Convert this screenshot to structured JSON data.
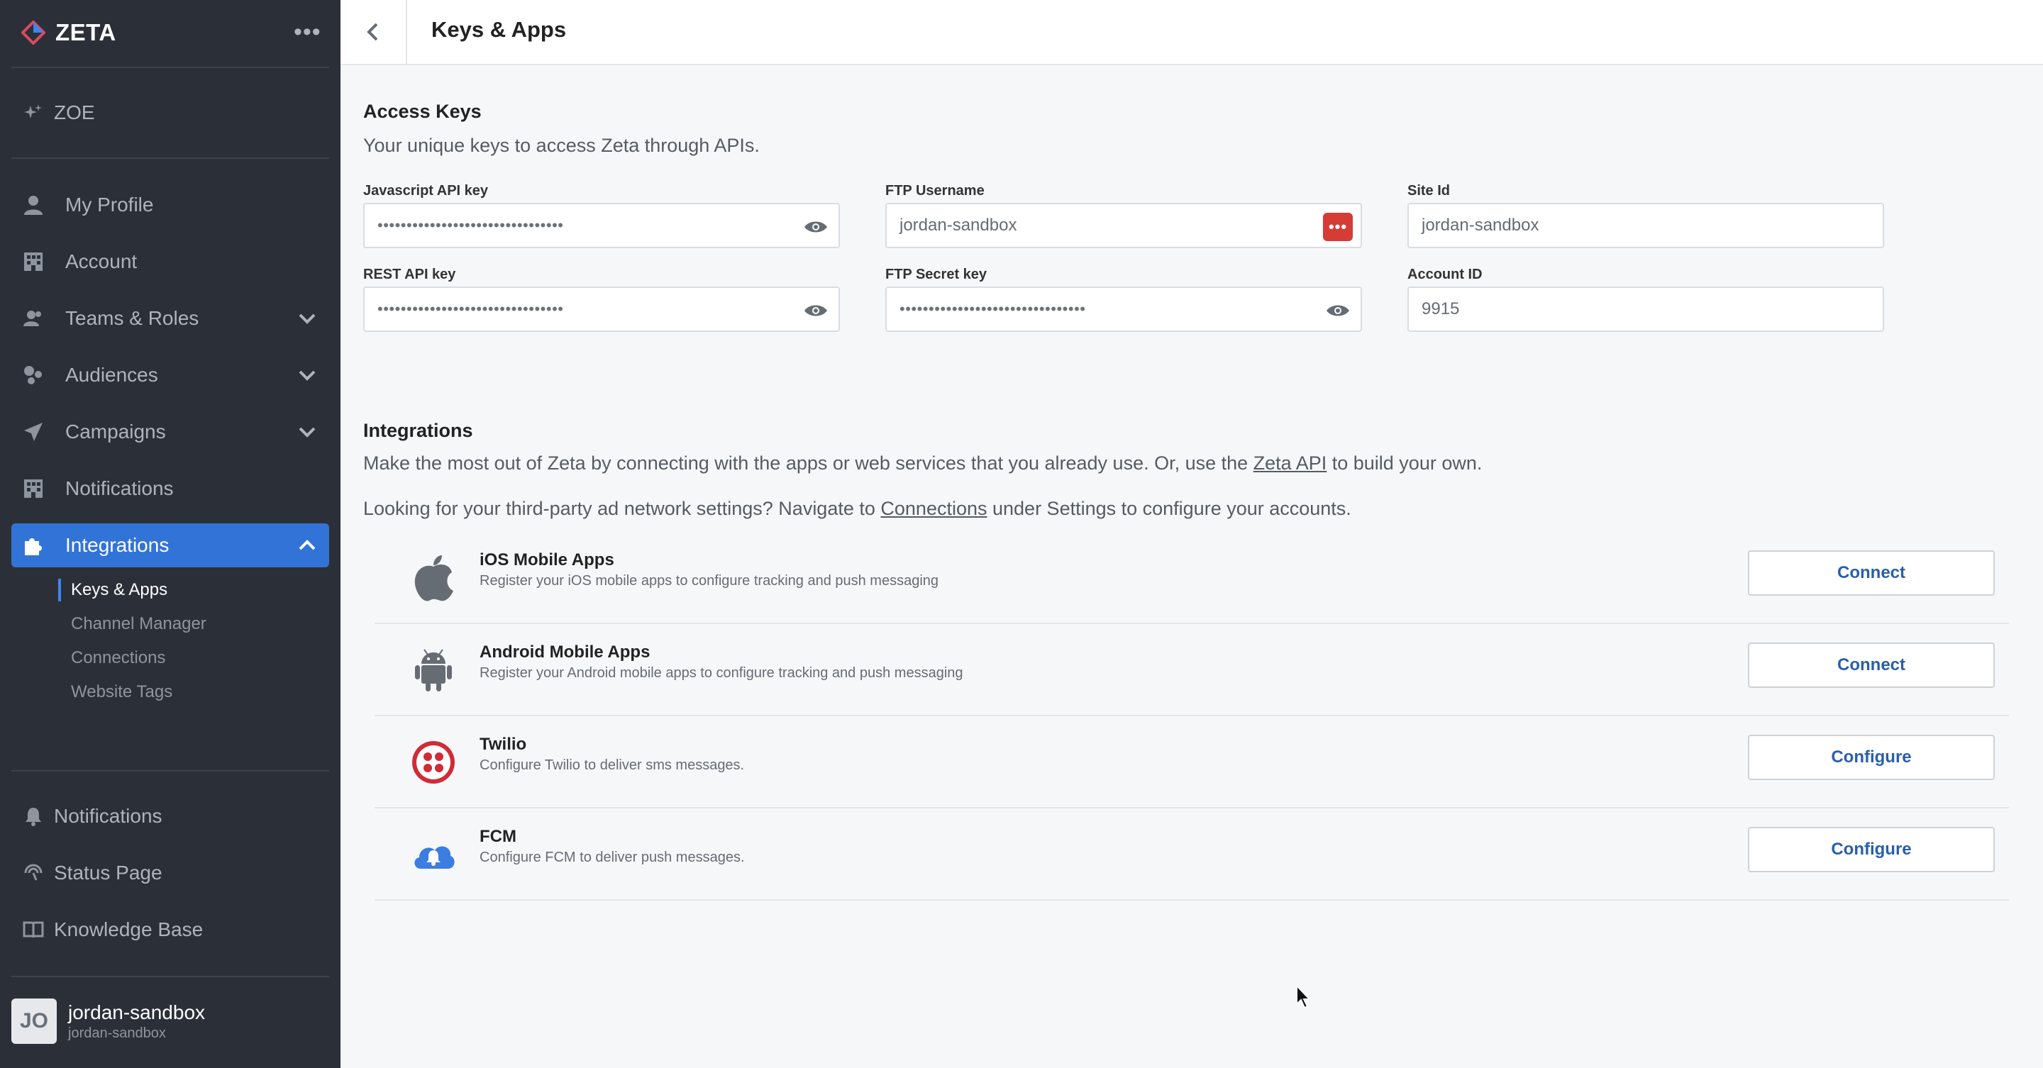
{
  "brand": {
    "name": "ZETA"
  },
  "sidebar": {
    "top_item": {
      "label": "ZOE"
    },
    "items": [
      {
        "label": "My Profile"
      },
      {
        "label": "Account"
      },
      {
        "label": "Teams & Roles"
      },
      {
        "label": "Audiences"
      },
      {
        "label": "Campaigns"
      },
      {
        "label": "Notifications"
      },
      {
        "label": "Integrations"
      }
    ],
    "sub_items": [
      {
        "label": "Keys & Apps"
      },
      {
        "label": "Channel Manager"
      },
      {
        "label": "Connections"
      },
      {
        "label": "Website Tags"
      }
    ],
    "footer_items": [
      {
        "label": "Notifications"
      },
      {
        "label": "Status Page"
      },
      {
        "label": "Knowledge Base"
      }
    ],
    "user": {
      "initials": "JO",
      "name": "jordan-sandbox",
      "sub": "jordan-sandbox"
    }
  },
  "header": {
    "title": "Keys & Apps"
  },
  "access_keys": {
    "title": "Access Keys",
    "description": "Your unique keys to access Zeta through APIs.",
    "fields": {
      "js_api_key": {
        "label": "Javascript API key",
        "value": "••••••••••••••••••••••••••••••••"
      },
      "ftp_username": {
        "label": "FTP Username",
        "value": "jordan-sandbox"
      },
      "site_id": {
        "label": "Site Id",
        "value": "jordan-sandbox"
      },
      "rest_api_key": {
        "label": "REST API key",
        "value": "••••••••••••••••••••••••••••••••"
      },
      "ftp_secret_key": {
        "label": "FTP Secret key",
        "value": "••••••••••••••••••••••••••••••••"
      },
      "account_id": {
        "label": "Account ID",
        "value": "9915"
      }
    }
  },
  "integrations": {
    "title": "Integrations",
    "desc1_before": "Make the most out of Zeta by connecting with the apps or web services that you already use. Or, use the ",
    "desc1_link": "Zeta API",
    "desc1_after": " to build your own.",
    "desc2_before": "Looking for your third-party ad network settings? Navigate to ",
    "desc2_link": "Connections",
    "desc2_after": " under Settings to configure your accounts.",
    "items": [
      {
        "name": "iOS Mobile Apps",
        "description": "Register your iOS mobile apps to configure tracking and push messaging",
        "button": "Connect",
        "icon": "apple-icon"
      },
      {
        "name": "Android Mobile Apps",
        "description": "Register your Android mobile apps to configure tracking and push messaging",
        "button": "Connect",
        "icon": "android-icon"
      },
      {
        "name": "Twilio",
        "description": "Configure Twilio to deliver sms messages.",
        "button": "Configure",
        "icon": "twilio-icon"
      },
      {
        "name": "FCM",
        "description": "Configure FCM to deliver push messages.",
        "button": "Configure",
        "icon": "fcm-cloud-icon"
      }
    ]
  },
  "colors": {
    "sidebar_bg": "#2b3038",
    "active_nav": "#3273d8",
    "link_button_text": "#2a5fa8",
    "twilio_red": "#d12b35",
    "fcm_blue": "#3b7de0"
  }
}
